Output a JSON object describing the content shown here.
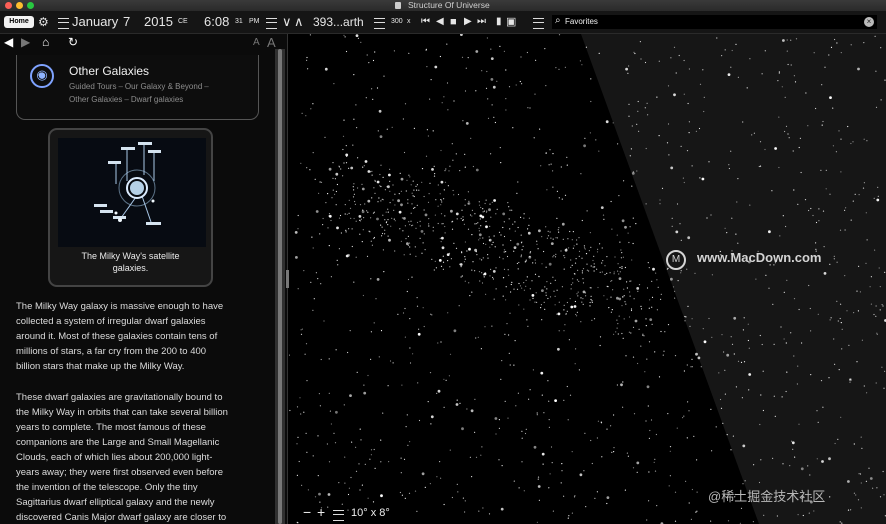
{
  "window": {
    "title": "Structure Of Universe"
  },
  "toolbar": {
    "home_label": "Home",
    "month": "January",
    "day": "7",
    "year": "2015",
    "era": "CE",
    "time": "6:08",
    "seconds": "31",
    "ampm": "PM",
    "location": "393...arth",
    "rate": "300",
    "rate_unit": "x",
    "search_placeholder": "Favorites",
    "icons": [
      "home-icon",
      "telescope-icon",
      "menu-icon",
      "play-icon",
      "stop-icon",
      "pause-icon",
      "layout-icon",
      "search-icon",
      "close-icon"
    ]
  },
  "sidebar": {
    "nav": {
      "back": "◀",
      "forward": "▶",
      "home": "⌂",
      "refresh": "↻",
      "font_small": "A",
      "font_large": "A"
    },
    "location": {
      "title": "Other Galaxies",
      "crumbs": [
        "Guided Tours",
        "Our Galaxy & Beyond",
        "Other Galaxies",
        "Dwarf galaxies"
      ]
    },
    "image_card": {
      "caption_line1": "The Milky Way's satellite",
      "caption_line2": "galaxies."
    },
    "paragraphs": [
      [
        "The Milky Way galaxy is massive enough to have",
        "collected a system of irregular dwarf galaxies",
        "around it. Most of these galaxies contain tens of",
        "millions of stars, a far cry from the 200 to 400",
        "billion stars that make up the Milky Way."
      ],
      [
        "These dwarf galaxies are gravitationally bound to",
        "the Milky Way in orbits that can take several billion",
        "years to complete. The most famous of these",
        "companions are the Large and Small Magellanic",
        "Clouds, each of which lies about 200,000 light-",
        "years away; they were first observed even before",
        "the invention of the telescope. Only the tiny",
        "Sagittarius dwarf elliptical galaxy and the newly",
        "discovered Canis Major dwarf galaxy are closer to"
      ]
    ]
  },
  "sky": {
    "zoom_minus": "−",
    "zoom_plus": "+",
    "field_of_view": "10° x 8°",
    "watermark_main": "www.MacDown.com",
    "watermark_corner": "@稀土掘金技术社区"
  },
  "colors": {
    "galaxy_icon": "#7fa3ff",
    "star": "#ffffff",
    "panel": "#0b0b0b"
  }
}
